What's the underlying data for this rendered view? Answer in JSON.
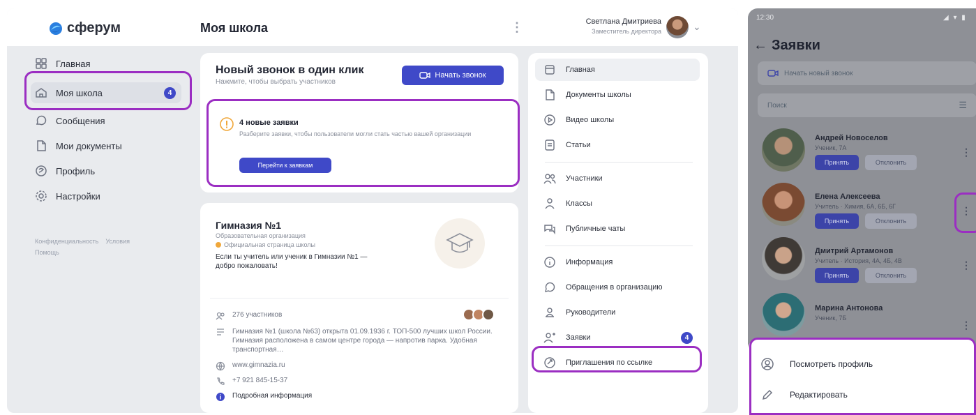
{
  "app": {
    "logo_text": "сферум",
    "page_title": "Моя школа",
    "kebab": "⋮",
    "user": {
      "name": "Светлана Дмитриева",
      "role": "Заместитель директора"
    },
    "colors": {
      "accent": "#3f49c8",
      "highlight": "#9b2ec2",
      "app_bg": "#e9ebee"
    }
  },
  "sidebar": {
    "items": [
      {
        "label": "Главная",
        "icon": "grid-icon"
      },
      {
        "label": "Моя школа",
        "icon": "school-icon",
        "badge": "4"
      },
      {
        "label": "Сообщения",
        "icon": "chat-icon"
      },
      {
        "label": "Мои документы",
        "icon": "document-icon"
      },
      {
        "label": "Профиль",
        "icon": "profile-icon"
      },
      {
        "label": "Настройки",
        "icon": "settings-icon"
      }
    ],
    "footer_privacy": "Конфиденциальность",
    "footer_terms": "Условия",
    "footer_help": "Помощь"
  },
  "call_card": {
    "title": "Новый звонок в один клик",
    "subtitle": "Нажмите, чтобы выбрать участников",
    "button": "Начать звонок"
  },
  "requests_card": {
    "title": "4 новые заявки",
    "text": "Разберите заявки, чтобы пользователи могли стать частью вашей организации",
    "button": "Перейти к заявкам"
  },
  "school_card": {
    "title": "Гимназия №1",
    "type": "Образовательная организация",
    "verified": "Официальная страница школы",
    "welcome": "Если ты учитель или ученик в Гимназии №1 — добро пожаловать!",
    "members": "276 участников",
    "description": "Гимназия №1 (школа №63) открыта 01.09.1936 г. ТОП-500 лучших школ России. Гимназия расположена в самом центре города — напротив парка. Удобная транспортная…",
    "website": "www.gimnazia.ru",
    "phone": "+7 921 845-15-37",
    "more": "Подробная информация"
  },
  "right_menu": {
    "items": [
      {
        "label": "Главная",
        "icon": "home-icon"
      },
      {
        "label": "Документы школы",
        "icon": "document-icon"
      },
      {
        "label": "Видео школы",
        "icon": "play-icon"
      },
      {
        "label": "Статьи",
        "icon": "article-icon"
      },
      {
        "label": "Участники",
        "icon": "users-icon"
      },
      {
        "label": "Классы",
        "icon": "classes-icon"
      },
      {
        "label": "Публичные чаты",
        "icon": "chats-icon"
      },
      {
        "label": "Информация",
        "icon": "info-icon"
      },
      {
        "label": "Обращения в организацию",
        "icon": "chat-icon"
      },
      {
        "label": "Руководители",
        "icon": "person-icon"
      },
      {
        "label": "Заявки",
        "icon": "add-person-icon",
        "badge": "4"
      },
      {
        "label": "Приглашения по ссылке",
        "icon": "link-icon"
      }
    ]
  },
  "phone": {
    "time": "12:30",
    "title": "Заявки",
    "start_call": "Начать новый звонок",
    "search_placeholder": "Поиск",
    "accept": "Принять",
    "reject": "Отклонить",
    "people": [
      {
        "name": "Андрей Новоселов",
        "role": "Ученик, 7А"
      },
      {
        "name": "Елена Алексеева",
        "role": "Учитель · Химия, 6А, 6Б, 6Г"
      },
      {
        "name": "Дмитрий Артамонов",
        "role": "Учитель · История, 4А, 4Б, 4В"
      },
      {
        "name": "Марина Антонова",
        "role": "Ученик, 7Б"
      }
    ],
    "sheet": {
      "view_profile": "Посмотреть профиль",
      "edit": "Редактировать"
    }
  }
}
